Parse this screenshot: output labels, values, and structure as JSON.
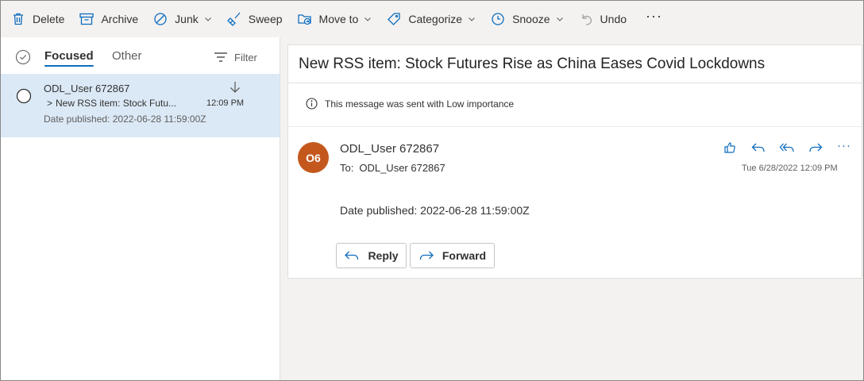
{
  "toolbar": {
    "delete": "Delete",
    "archive": "Archive",
    "junk": "Junk",
    "sweep": "Sweep",
    "move_to": "Move to",
    "categorize": "Categorize",
    "snooze": "Snooze",
    "undo": "Undo",
    "more": "···"
  },
  "list": {
    "tabs": {
      "focused": "Focused",
      "other": "Other"
    },
    "filter": "Filter",
    "items": [
      {
        "sender": "ODL_User 672867",
        "subject_chevron": ">",
        "subject": "New RSS item: Stock Futu...",
        "time": "12:09 PM",
        "preview": "Date published: 2022-06-28 11:59:00Z"
      }
    ]
  },
  "reading": {
    "subject": "New RSS item: Stock Futures Rise as China Eases Covid Lockdowns",
    "importance_note": "This message was sent with Low importance",
    "avatar_initials": "O6",
    "from": "ODL_User 672867",
    "to_label": "To:",
    "to": "ODL_User 672867",
    "date": "Tue 6/28/2022 12:09 PM",
    "body": "Date published: 2022-06-28 11:59:00Z",
    "more": "···",
    "reply_button": "Reply",
    "forward_button": "Forward"
  },
  "colors": {
    "accent": "#0f6cbd",
    "selected_item": "#dbe9f7",
    "avatar": "#c4581c",
    "background": "#f3f2f1"
  }
}
